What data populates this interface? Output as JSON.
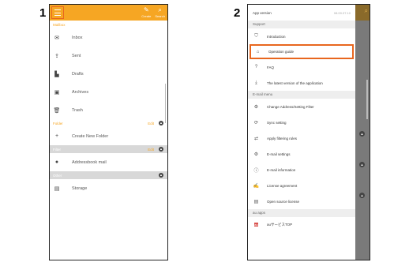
{
  "steps": [
    "1",
    "2"
  ],
  "screen1": {
    "actions": [
      {
        "label": "Create",
        "icon": "pencil-icon"
      },
      {
        "label": "Search",
        "icon": "search-icon"
      }
    ],
    "mailbox_label": "Mailbox",
    "mailbox_items": [
      {
        "label": "Inbox",
        "icon": "inbox-icon"
      },
      {
        "label": "Sent",
        "icon": "sent-icon"
      },
      {
        "label": "Drafts",
        "icon": "drafts-icon"
      },
      {
        "label": "Archives",
        "icon": "archive-icon"
      },
      {
        "label": "Trash",
        "icon": "trash-icon"
      }
    ],
    "folder_label": "Folder",
    "folder_edit": "Edit",
    "new_folder": "Create New Folder",
    "filter_label": "Filter",
    "filter_edit": "Edit",
    "addressbook_mail": "Addressbook mail",
    "other_label": "Other",
    "storage": "Storage"
  },
  "screen2": {
    "app_version_label": "App version",
    "app_version_value": "08.00.07.10",
    "support_label": "Support",
    "support_items": [
      {
        "label": "Introduction",
        "icon": "shield-icon"
      },
      {
        "label": "Operation guide",
        "icon": "guide-icon"
      },
      {
        "label": "FAQ",
        "icon": "help-icon"
      },
      {
        "label": "The latest version of the application",
        "icon": "download-icon"
      }
    ],
    "email_menu_label": "E-mail menu",
    "email_items": [
      {
        "label": "Change Address/Setting Filter",
        "icon": "settings-gear-icon"
      },
      {
        "label": "Sync setting",
        "icon": "sync-icon"
      },
      {
        "label": "Apply filtering rules",
        "icon": "filter-icon"
      },
      {
        "label": "E-mail settings",
        "icon": "email-settings-icon"
      },
      {
        "label": "E-mail information",
        "icon": "info-icon"
      },
      {
        "label": "License agreement",
        "icon": "license-icon"
      },
      {
        "label": "Open source license",
        "icon": "open-source-icon"
      }
    ],
    "au_apps_label": "au apps",
    "au_item": "auサービスTOP"
  },
  "colors": {
    "accent": "#f6a623",
    "highlight": "#e8661e"
  }
}
